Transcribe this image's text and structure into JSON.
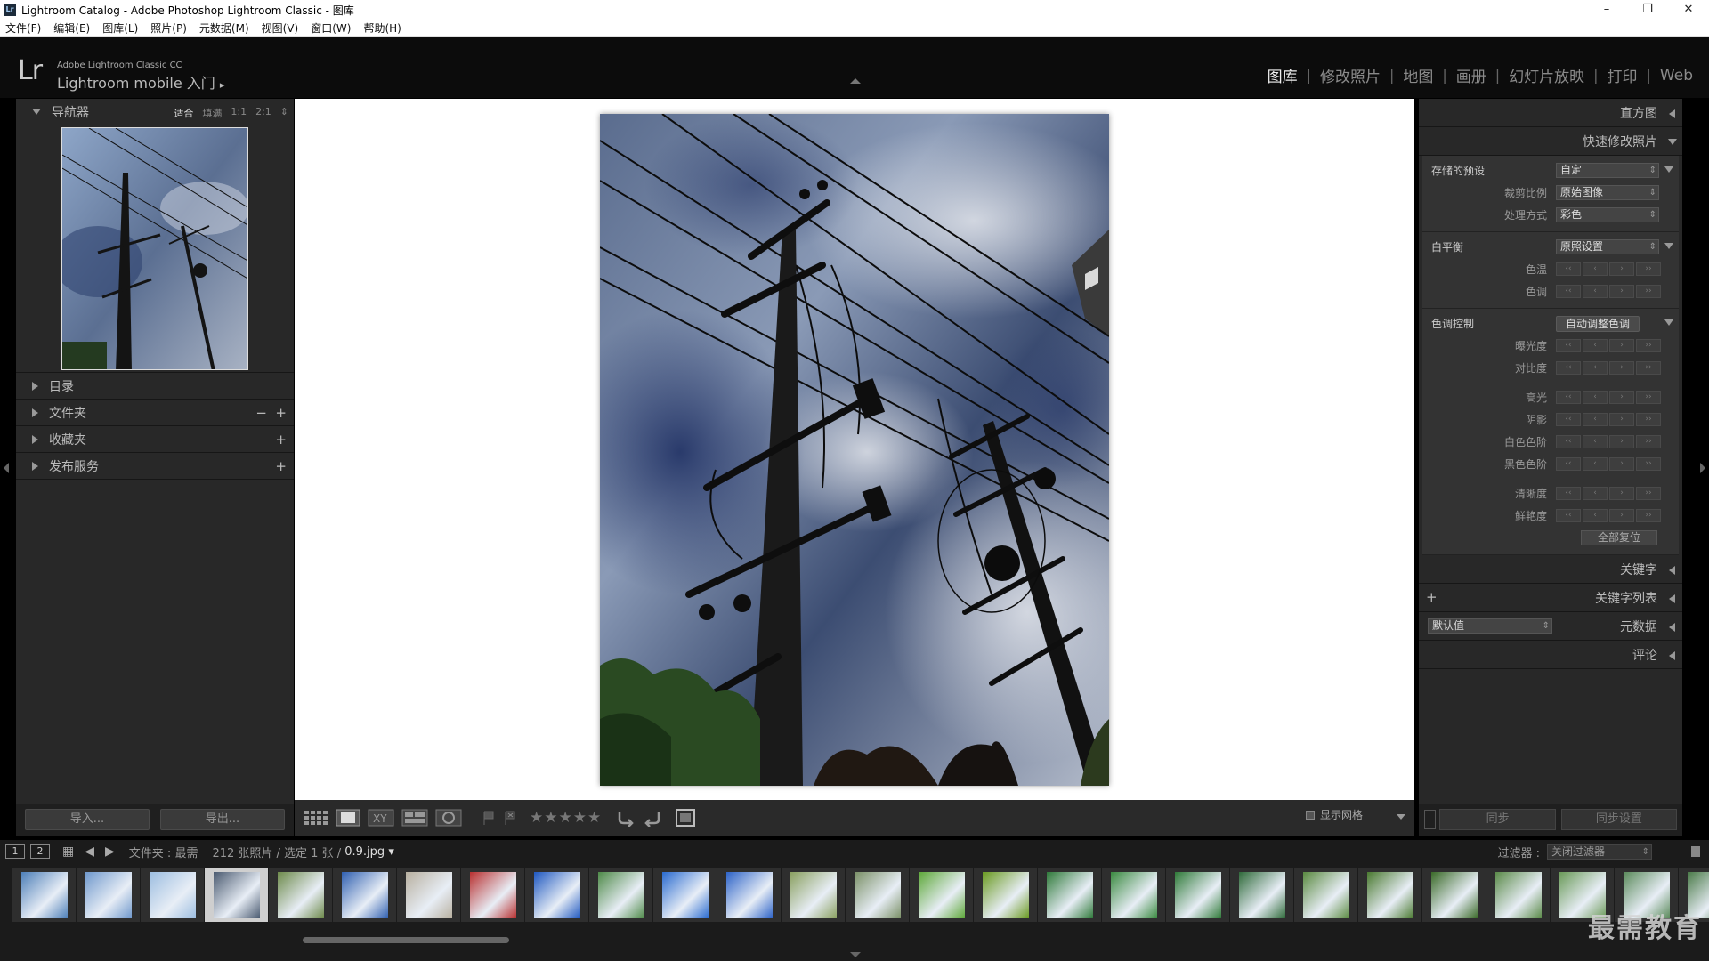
{
  "window": {
    "title": "Lightroom Catalog - Adobe Photoshop Lightroom Classic - 图库",
    "controls": [
      "–",
      "❐",
      "✕"
    ]
  },
  "menu": [
    "文件(F)",
    "编辑(E)",
    "图库(L)",
    "照片(P)",
    "元数据(M)",
    "视图(V)",
    "窗口(W)",
    "帮助(H)"
  ],
  "identity": {
    "logo": "Lr",
    "product": "Adobe Lightroom Classic CC",
    "mobile": "Lightroom mobile 入门",
    "mobile_arrow": "▸"
  },
  "modules": [
    "图库",
    "修改照片",
    "地图",
    "画册",
    "幻灯片放映",
    "打印",
    "Web"
  ],
  "modules_active": "图库",
  "left": {
    "navigator": "导航器",
    "zoom": [
      "适合",
      "填满",
      "1:1",
      "2:1",
      "⇕"
    ],
    "catalog": "目录",
    "folders": "文件夹",
    "collections": "收藏夹",
    "publish": "发布服务",
    "minus": "−",
    "plus": "+",
    "import": "导入...",
    "export": "导出..."
  },
  "toolbar": {
    "grid_icon": "grid-view-icon",
    "stars": "★★★★★",
    "show_grid": "显示网格"
  },
  "right": {
    "histogram": "直方图",
    "quick_develop": "快速修改照片",
    "saved_preset": {
      "label": "存储的预设",
      "value": "自定"
    },
    "crop": {
      "label": "裁剪比例",
      "value": "原始图像"
    },
    "treatment": {
      "label": "处理方式",
      "value": "彩色"
    },
    "white_balance": {
      "label": "白平衡",
      "value": "原照设置"
    },
    "temp": "色温",
    "tint": "色调",
    "tone_control": "色调控制",
    "auto_tone": "自动调整色调",
    "exposure": "曝光度",
    "contrast": "对比度",
    "highlights": "高光",
    "shadows": "阴影",
    "whites": "白色色阶",
    "blacks": "黑色色阶",
    "clarity": "清晰度",
    "vibrance": "鲜艳度",
    "reset_all": "全部复位",
    "keywording": "关键字",
    "keyword_list": "关键字列表",
    "metadata": "元数据",
    "metadata_preset": "默认值",
    "comments": "评论",
    "add": "+",
    "sync": "同步",
    "sync_settings": "同步设置",
    "step_btns": [
      "‹‹",
      "‹",
      "›",
      "››"
    ]
  },
  "filmstrip": {
    "screen1": "1",
    "screen2": "2",
    "source": "文件夹 : 最需",
    "count": "212 张照片 / 选定 1 张 /",
    "filename": "0.9.jpg",
    "dd": "▾",
    "filter_label": "过滤器 :",
    "filter_value": "关闭过滤器",
    "thumbs": [
      "#4d7fb8",
      "#6f98cc",
      "#9cbde0",
      "#4a5a70",
      "#6d8a4a",
      "#2f5fb0",
      "#b8b0a0",
      "#b83030",
      "#1f58c0",
      "#4e8a48",
      "#2a6bd0",
      "#2d63c8",
      "#8aa060",
      "#7a9066",
      "#5da838",
      "#6a9a20",
      "#2f7a3a",
      "#3a8a40",
      "#2f7a38",
      "#2f6a3a",
      "#5a8a40",
      "#4a7a30",
      "#3a6a28",
      "#5a8a48",
      "#6a9a58",
      "#5a8a5a",
      "#4a7a48"
    ],
    "selected_index": 3
  },
  "watermark": "最需教育",
  "colors": {
    "panel": "#282828",
    "active_text": "#eeeeee",
    "selected_cell": "#cfcfcf"
  }
}
